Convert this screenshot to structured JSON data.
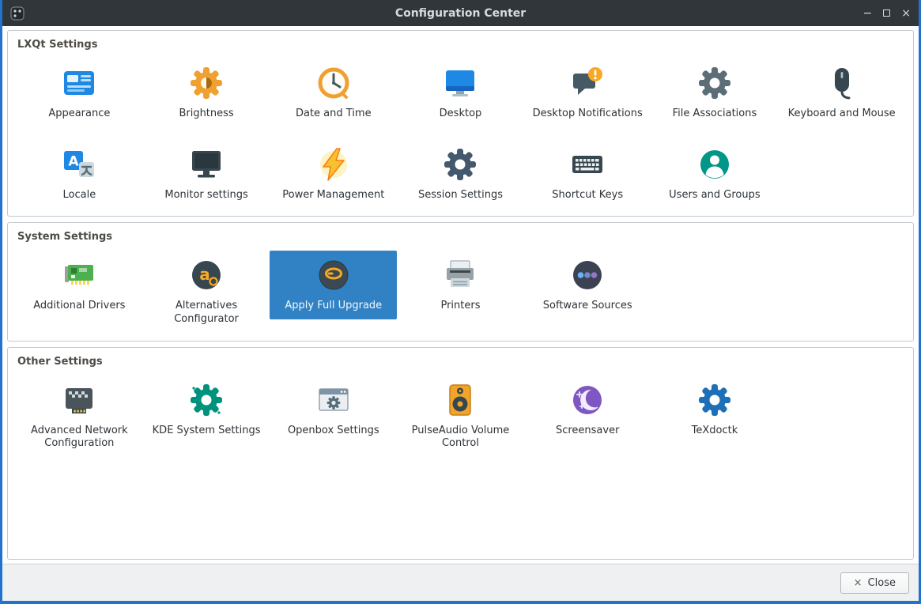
{
  "window": {
    "title": "Configuration Center",
    "app_icon": "configuration-center-icon",
    "controls": {
      "minimize": "−",
      "close": "×"
    }
  },
  "colors": {
    "titlebar_bg": "#31363a",
    "window_border": "#2273cc",
    "selection_bg": "#3182c4",
    "content_bg": "#ffffff",
    "footer_bg": "#eef0f1",
    "group_title_text": "#4e4b46",
    "label_text": "#2e3338"
  },
  "groups": [
    {
      "title": "LXQt Settings",
      "items": [
        {
          "label": "Appearance",
          "icon": "appearance-icon"
        },
        {
          "label": "Brightness",
          "icon": "brightness-icon"
        },
        {
          "label": "Date and Time",
          "icon": "date-time-icon"
        },
        {
          "label": "Desktop",
          "icon": "desktop-icon"
        },
        {
          "label": "Desktop Notifications",
          "icon": "desktop-notifications-icon"
        },
        {
          "label": "File Associations",
          "icon": "file-associations-icon"
        },
        {
          "label": "Keyboard and Mouse",
          "icon": "keyboard-mouse-icon"
        },
        {
          "label": "Locale",
          "icon": "locale-icon"
        },
        {
          "label": "Monitor settings",
          "icon": "monitor-settings-icon"
        },
        {
          "label": "Power Management",
          "icon": "power-management-icon"
        },
        {
          "label": "Session Settings",
          "icon": "session-settings-icon"
        },
        {
          "label": "Shortcut Keys",
          "icon": "shortcut-keys-icon"
        },
        {
          "label": "Users and Groups",
          "icon": "users-groups-icon"
        }
      ]
    },
    {
      "title": "System Settings",
      "items": [
        {
          "label": "Additional Drivers",
          "icon": "additional-drivers-icon"
        },
        {
          "label": "Alternatives Configurator",
          "icon": "alternatives-configurator-icon"
        },
        {
          "label": "Apply Full Upgrade",
          "icon": "apply-full-upgrade-icon",
          "selected": true
        },
        {
          "label": "Printers",
          "icon": "printers-icon"
        },
        {
          "label": "Software Sources",
          "icon": "software-sources-icon"
        }
      ]
    },
    {
      "title": "Other Settings",
      "items": [
        {
          "label": "Advanced Network Configuration",
          "icon": "advanced-network-configuration-icon"
        },
        {
          "label": "KDE System Settings",
          "icon": "kde-system-settings-icon"
        },
        {
          "label": "Openbox Settings",
          "icon": "openbox-settings-icon"
        },
        {
          "label": "PulseAudio Volume Control",
          "icon": "pulseaudio-volume-control-icon"
        },
        {
          "label": "Screensaver",
          "icon": "screensaver-icon"
        },
        {
          "label": "TeXdoctk",
          "icon": "texdoctk-icon"
        }
      ]
    }
  ],
  "footer": {
    "close_label": "Close",
    "close_icon": "×"
  }
}
